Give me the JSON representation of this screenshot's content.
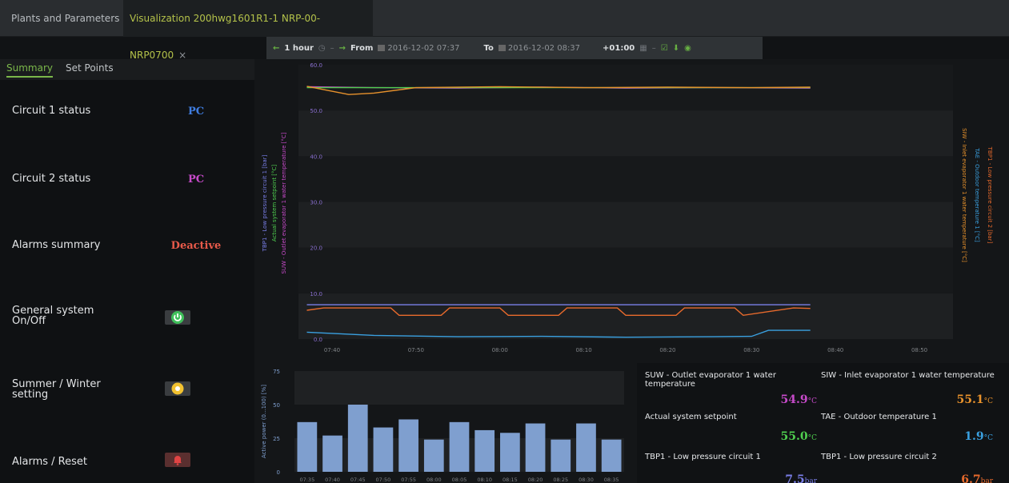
{
  "tabs": {
    "plants": "Plants and Parameters",
    "visualization": "Visualization 200hwg1601R1-1 NRP-00-NRP0700",
    "close": "×"
  },
  "toolbar": {
    "range": "1 hour",
    "from_label": "From",
    "from_value": "2016-12-02 07:37",
    "to_label": "To",
    "to_value": "2016-12-02 08:37",
    "tz": "+01:00"
  },
  "subtabs": {
    "summary": "Summary",
    "setpoints": "Set Points"
  },
  "summary": {
    "circuit1": {
      "label": "Circuit 1 status",
      "value": "PC",
      "color": "#3f7de0"
    },
    "circuit2": {
      "label": "Circuit 2 status",
      "value": "PC",
      "color": "#c64ac9"
    },
    "alarms": {
      "label": "Alarms summary",
      "value": "Deactive",
      "color": "#e85a4a"
    },
    "general": {
      "label_line1": "General system",
      "label_line2": "On/Off",
      "icon": "power-icon"
    },
    "summer": {
      "label_line1": "Summer / Winter",
      "label_line2": "setting",
      "icon": "sun-icon"
    },
    "reset": {
      "label": "Alarms / Reset",
      "icon": "bell-icon"
    }
  },
  "chart_data": [
    {
      "type": "line",
      "x_ticks": [
        "07:40",
        "07:50",
        "08:00",
        "08:10",
        "08:20",
        "08:30",
        "08:40",
        "08:50"
      ],
      "y_ticks": [
        "0.0",
        "10.0",
        "20.0",
        "30.0",
        "40.0",
        "50.0",
        "60.0"
      ],
      "ylim": [
        0,
        60
      ],
      "left_axis_labels": [
        {
          "text": "TBP1 - Low pressure circuit 1 [bar]",
          "color": "#7a7fe8"
        },
        {
          "text": "Actual system setpoint [°C]",
          "color": "#4fcf4f"
        },
        {
          "text": "SUW - Outlet evaporator 1 water temperature [°C]",
          "color": "#c64ac9"
        }
      ],
      "right_axis_labels": [
        {
          "text": "SIW - Inlet evaporator 1 water temperature [°C]",
          "color": "#e8922c"
        },
        {
          "text": "TAE - Outdoor temperature 1 [°C]",
          "color": "#3aa0e0"
        },
        {
          "text": "TBP1 - Low pressure circuit 2 [bar]",
          "color": "#e86a2c"
        }
      ],
      "series": [
        {
          "name": "SUW - Outlet evaporator 1 water temperature",
          "color": "#c64ac9",
          "x": [
            "07:37",
            "07:45",
            "07:55",
            "08:05",
            "08:15",
            "08:25",
            "08:37"
          ],
          "values": [
            55.2,
            55.0,
            54.9,
            55.1,
            54.9,
            55.0,
            54.9
          ]
        },
        {
          "name": "Actual system setpoint",
          "color": "#4fcf4f",
          "x": [
            "07:37",
            "08:37"
          ],
          "values": [
            55.0,
            55.0
          ]
        },
        {
          "name": "SIW - Inlet evaporator 1 water temperature",
          "color": "#e8922c",
          "x": [
            "07:37",
            "07:42",
            "07:45",
            "07:50",
            "08:00",
            "08:10",
            "08:20",
            "08:30",
            "08:37"
          ],
          "values": [
            55.3,
            53.5,
            53.8,
            55.0,
            55.2,
            55.0,
            55.1,
            55.0,
            55.1
          ]
        },
        {
          "name": "TBP1 - Low pressure circuit 1",
          "color": "#7a7fe8",
          "x": [
            "07:37",
            "08:37"
          ],
          "values": [
            7.5,
            7.5
          ]
        },
        {
          "name": "TBP1 - Low pressure circuit 2",
          "color": "#e86a2c",
          "x": [
            "07:37",
            "07:39",
            "07:40",
            "07:47",
            "07:48",
            "07:53",
            "07:54",
            "08:00",
            "08:01",
            "08:07",
            "08:08",
            "08:14",
            "08:15",
            "08:21",
            "08:22",
            "08:28",
            "08:29",
            "08:35",
            "08:37"
          ],
          "values": [
            6.3,
            6.8,
            6.8,
            6.8,
            5.2,
            5.2,
            6.8,
            6.8,
            5.2,
            5.2,
            6.8,
            6.8,
            5.2,
            5.2,
            6.8,
            6.8,
            5.2,
            6.8,
            6.7
          ]
        },
        {
          "name": "TAE - Outdoor temperature 1",
          "color": "#3aa0e0",
          "x": [
            "07:37",
            "07:45",
            "07:55",
            "08:05",
            "08:15",
            "08:25",
            "08:30",
            "08:32",
            "08:37"
          ],
          "values": [
            1.5,
            0.8,
            0.5,
            0.6,
            0.4,
            0.5,
            0.6,
            1.9,
            1.9
          ]
        }
      ]
    },
    {
      "type": "bar",
      "ylabel": "Active power (0...100) [%]",
      "y_ticks": [
        "0",
        "25",
        "50",
        "75"
      ],
      "ylim": [
        0,
        75
      ],
      "categories": [
        "07:35",
        "07:40",
        "07:45",
        "07:50",
        "07:55",
        "08:00",
        "08:05",
        "08:10",
        "08:15",
        "08:20",
        "08:25",
        "08:30",
        "08:35"
      ],
      "values": [
        37,
        27,
        50,
        33,
        39,
        24,
        37,
        31,
        29,
        36,
        24,
        36,
        24
      ],
      "color": "#7f9fcf"
    }
  ],
  "values_panel": [
    {
      "label": "SUW - Outlet evaporator 1 water temperature",
      "value": "54.9",
      "unit": "°C",
      "color": "#c64ac9"
    },
    {
      "label": "SIW - Inlet evaporator 1 water temperature",
      "value": "55.1",
      "unit": "°C",
      "color": "#e8922c"
    },
    {
      "label": "Actual system setpoint",
      "value": "55.0",
      "unit": "°C",
      "color": "#4fcf4f"
    },
    {
      "label": "TAE - Outdoor temperature 1",
      "value": "1.9",
      "unit": "°C",
      "color": "#3aa0e0"
    },
    {
      "label": "TBP1 - Low pressure circuit 1",
      "value": "7.5",
      "unit": "bar",
      "color": "#7a7fe8"
    },
    {
      "label": "TBP1 - Low pressure circuit 2",
      "value": "6.7",
      "unit": "bar",
      "color": "#e86a2c"
    }
  ]
}
